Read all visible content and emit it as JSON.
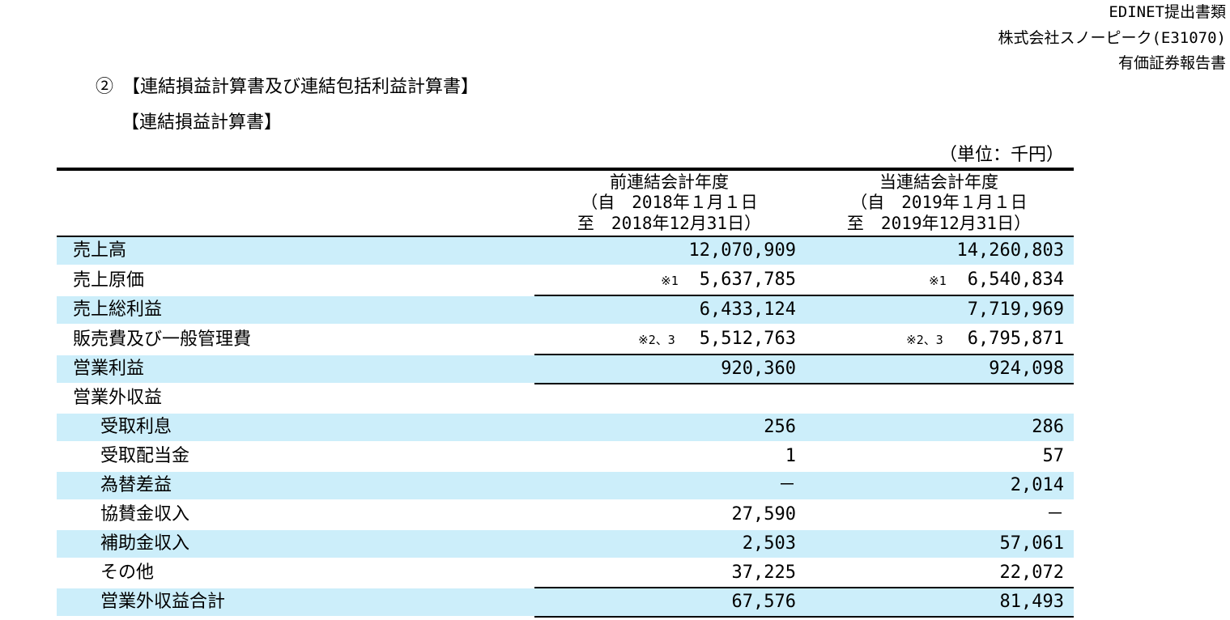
{
  "header": {
    "line1": "EDINET提出書類",
    "line2": "株式会社スノーピーク(E31070)",
    "line3": "有価証券報告書"
  },
  "section_title": "②　【連結損益計算書及び連結包括利益計算書】",
  "sub_title": "【連結損益計算書】",
  "unit": "（単位：千円）",
  "columns": {
    "prev": {
      "line1": "前連結会計年度",
      "line2": "（自　2018年１月１日",
      "line3": "至　2018年12月31日）"
    },
    "curr": {
      "line1": "当連結会計年度",
      "line2": "（自　2019年１月１日",
      "line3": "至　2019年12月31日）"
    }
  },
  "rows": [
    {
      "label": "売上高",
      "prev": "12,070,909",
      "curr": "14,260,803",
      "prev_note": "",
      "curr_note": ""
    },
    {
      "label": "売上原価",
      "prev": "5,637,785",
      "curr": "6,540,834",
      "prev_note": "※1",
      "curr_note": "※1"
    },
    {
      "label": "売上総利益",
      "prev": "6,433,124",
      "curr": "7,719,969",
      "prev_note": "",
      "curr_note": ""
    },
    {
      "label": "販売費及び一般管理費",
      "prev": "5,512,763",
      "curr": "6,795,871",
      "prev_note": "※2、3",
      "curr_note": "※2、3"
    },
    {
      "label": "営業利益",
      "prev": "920,360",
      "curr": "924,098",
      "prev_note": "",
      "curr_note": ""
    },
    {
      "label": "営業外収益",
      "prev": "",
      "curr": "",
      "prev_note": "",
      "curr_note": ""
    },
    {
      "label": "受取利息",
      "prev": "256",
      "curr": "286",
      "prev_note": "",
      "curr_note": ""
    },
    {
      "label": "受取配当金",
      "prev": "1",
      "curr": "57",
      "prev_note": "",
      "curr_note": ""
    },
    {
      "label": "為替差益",
      "prev": "－",
      "curr": "2,014",
      "prev_note": "",
      "curr_note": ""
    },
    {
      "label": "協賛金収入",
      "prev": "27,590",
      "curr": "－",
      "prev_note": "",
      "curr_note": ""
    },
    {
      "label": "補助金収入",
      "prev": "2,503",
      "curr": "57,061",
      "prev_note": "",
      "curr_note": ""
    },
    {
      "label": "その他",
      "prev": "37,225",
      "curr": "22,072",
      "prev_note": "",
      "curr_note": ""
    },
    {
      "label": "営業外収益合計",
      "prev": "67,576",
      "curr": "81,493",
      "prev_note": "",
      "curr_note": ""
    }
  ],
  "colors": {
    "row_shade": "#cceefa",
    "text": "#000000"
  }
}
